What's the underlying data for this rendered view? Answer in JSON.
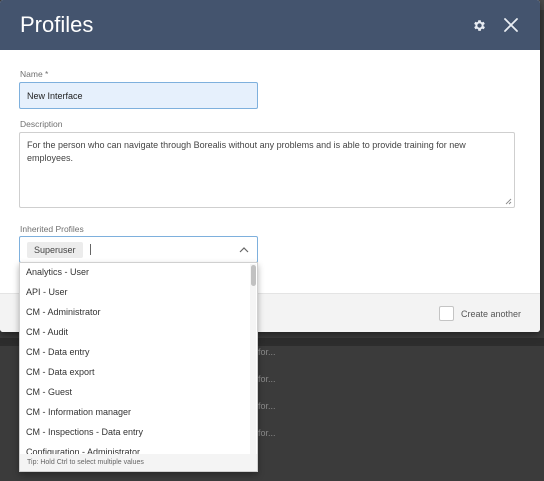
{
  "modal": {
    "title": "Profiles",
    "settings_icon": "gear-icon",
    "close_icon": "close-icon"
  },
  "form": {
    "name_label": "Name *",
    "name_value": "New Interface",
    "description_label": "Description",
    "description_value": "For the person who can navigate through Borealis without any problems and is able to provide training for new employees.",
    "inherited_label": "Inherited Profiles",
    "selected_chip": "Superuser"
  },
  "dropdown": {
    "options": [
      "Analytics - User",
      "API - User",
      "CM - Administrator",
      "CM - Audit",
      "CM - Data entry",
      "CM - Data export",
      "CM - Guest",
      "CM - Information manager",
      "CM - Inspections - Data entry",
      "Configuration - Administrator"
    ],
    "tip": "Tip: Hold Ctrl to select multiple values"
  },
  "footer": {
    "create_another_label": "Create another"
  },
  "background": {
    "row_texts": [
      "for...",
      "for...",
      "for...",
      "for..."
    ]
  },
  "colors": {
    "header": "#44546e",
    "accent": "#7eb0dd",
    "input_fill": "#e6f0fc"
  }
}
